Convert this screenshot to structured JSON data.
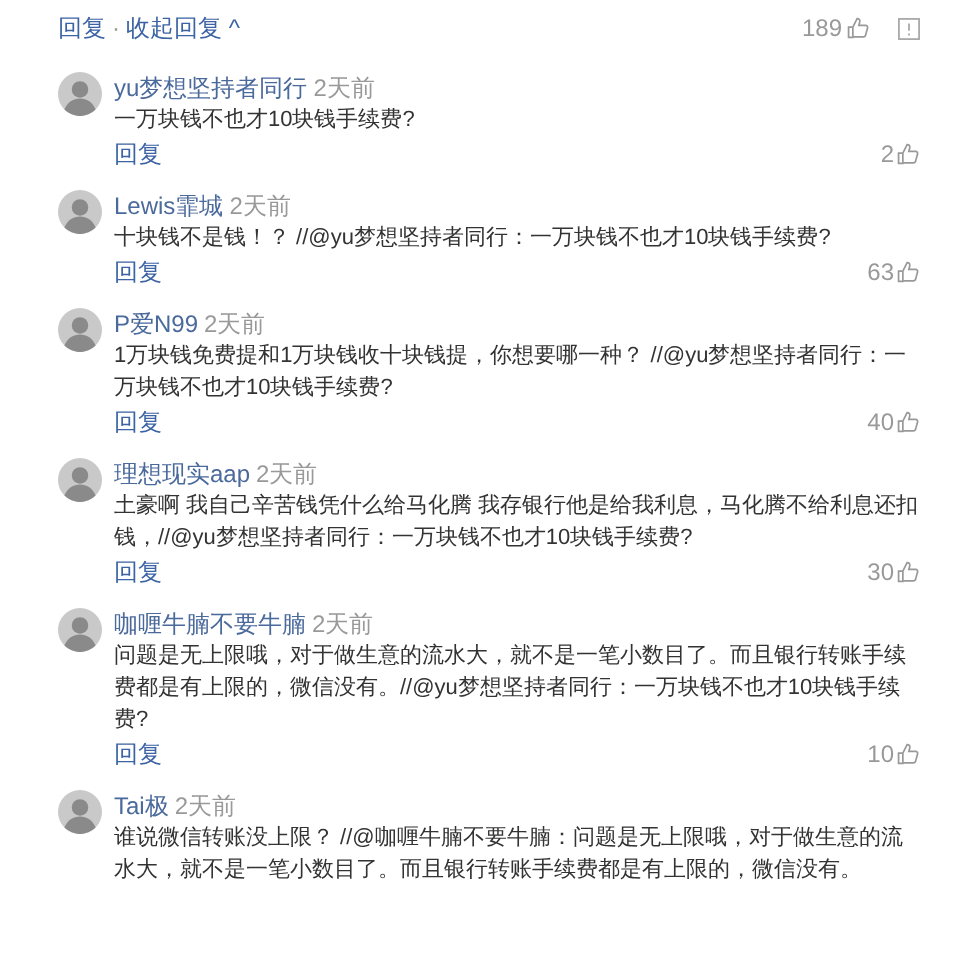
{
  "header": {
    "reply": "回复",
    "separator": "·",
    "collapse": "收起回复",
    "caret": "^",
    "likes": "189"
  },
  "comments": [
    {
      "name": "yu梦想坚持者同行",
      "time": "2天前",
      "text": "一万块钱不也才10块钱手续费?",
      "reply": "回复",
      "likes": "2"
    },
    {
      "name": "Lewis霏城",
      "time": "2天前",
      "text": "十块钱不是钱！？ //@yu梦想坚持者同行：一万块钱不也才10块钱手续费?",
      "reply": "回复",
      "likes": "63"
    },
    {
      "name": "P爱N99",
      "time": "2天前",
      "text": "1万块钱免费提和1万块钱收十块钱提，你想要哪一种？ //@yu梦想坚持者同行：一万块钱不也才10块钱手续费?",
      "reply": "回复",
      "likes": "40"
    },
    {
      "name": "理想现实aap",
      "time": "2天前",
      "text": "土豪啊 我自己辛苦钱凭什么给马化腾 我存银行他是给我利息，马化腾不给利息还扣钱，//@yu梦想坚持者同行：一万块钱不也才10块钱手续费?",
      "reply": "回复",
      "likes": "30"
    },
    {
      "name": "咖喱牛腩不要牛腩",
      "time": "2天前",
      "text": "问题是无上限哦，对于做生意的流水大，就不是一笔小数目了。而且银行转账手续费都是有上限的，微信没有。//@yu梦想坚持者同行：一万块钱不也才10块钱手续费?",
      "reply": "回复",
      "likes": "10"
    },
    {
      "name": "Tai极",
      "time": "2天前",
      "text": "谁说微信转账没上限？ //@咖喱牛腩不要牛腩：问题是无上限哦，对于做生意的流水大，就不是一笔小数目了。而且银行转账手续费都是有上限的，微信没有。"
    }
  ]
}
